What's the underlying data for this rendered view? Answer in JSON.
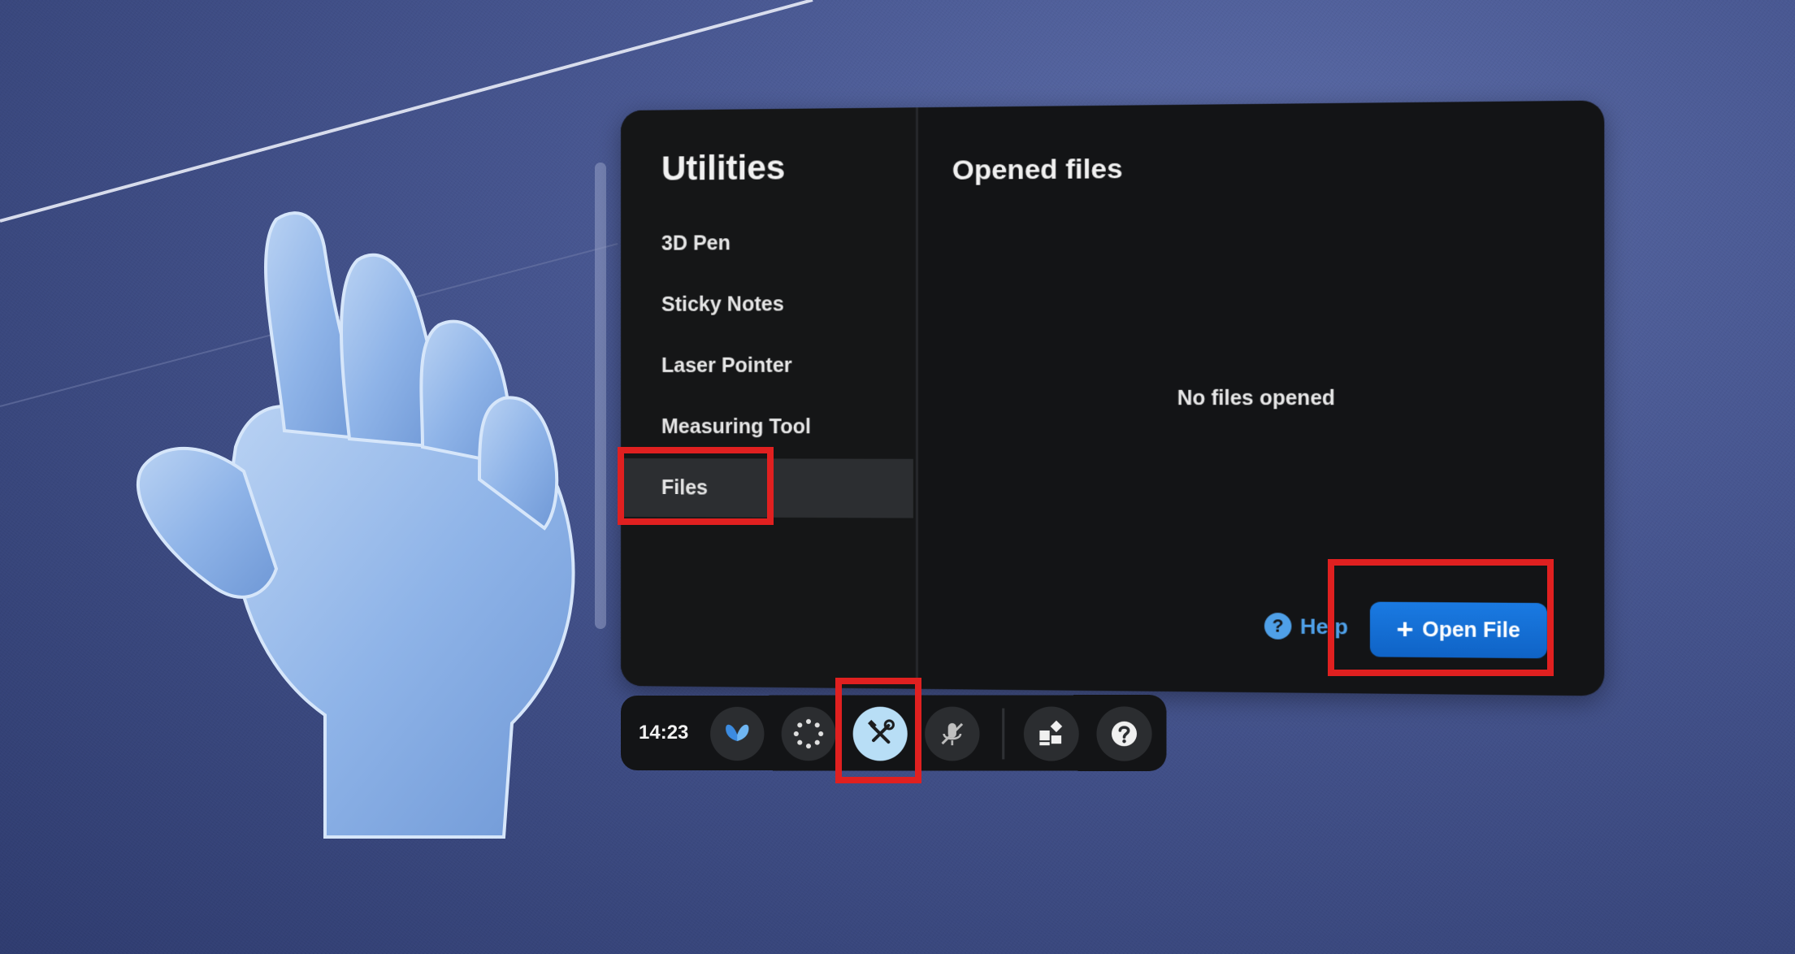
{
  "utilities": {
    "title": "Utilities",
    "items": [
      {
        "label": "3D Pen"
      },
      {
        "label": "Sticky Notes"
      },
      {
        "label": "Laser Pointer"
      },
      {
        "label": "Measuring Tool"
      },
      {
        "label": "Files",
        "active": true
      }
    ]
  },
  "files": {
    "title": "Opened files",
    "empty_message": "No files opened",
    "help_label": "Help",
    "help_icon_glyph": "?",
    "open_button_label": "Open File",
    "plus_glyph": "+"
  },
  "toolbar": {
    "clock": "14:23",
    "buttons": [
      {
        "icon": "butterfly-icon"
      },
      {
        "icon": "loading-dots-icon"
      },
      {
        "icon": "tools-icon",
        "active": true
      },
      {
        "icon": "mic-muted-icon"
      },
      {
        "icon": "apps-icon"
      },
      {
        "icon": "help-icon"
      }
    ]
  },
  "colors": {
    "panel_bg": "#131416",
    "accent_blue": "#1a7ae2",
    "active_tool_bg": "#b8def6",
    "highlight": "#e02020",
    "hand": "#8fb4e8"
  }
}
